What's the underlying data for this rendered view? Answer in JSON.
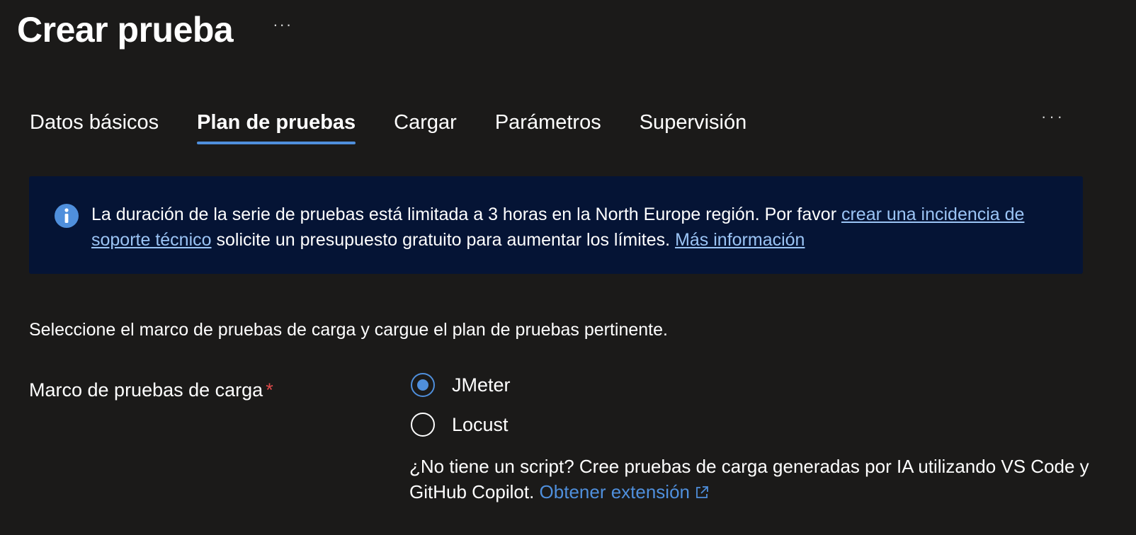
{
  "header": {
    "title": "Crear prueba",
    "more_label": "···"
  },
  "tabs": [
    {
      "label": "Datos básicos",
      "active": false
    },
    {
      "label": "Plan de pruebas",
      "active": true
    },
    {
      "label": "Cargar",
      "active": false
    },
    {
      "label": "Parámetros",
      "active": false
    },
    {
      "label": "Supervisión",
      "active": false
    }
  ],
  "tabs_more_label": "···",
  "info_banner": {
    "icon": "info-icon",
    "text_before": "La duración de la serie de pruebas está limitada a 3 horas en la North Europe región. Por favor ",
    "link1": "crear una incidencia de soporte técnico",
    "text_middle": " solicite un presupuesto gratuito para aumentar los límites. ",
    "link2": "Más información",
    "background": "#051435",
    "link_color": "#9bc4f5"
  },
  "instructions": "Seleccione el marco de pruebas de carga y cargue el plan de pruebas pertinente.",
  "framework_field": {
    "label": "Marco de pruebas de carga",
    "required_mark": "*",
    "options": [
      {
        "label": "JMeter",
        "selected": true
      },
      {
        "label": "Locust",
        "selected": false
      }
    ]
  },
  "helper": {
    "text": "¿No tiene un script? Cree pruebas de carga generadas por IA utilizando VS Code y GitHub Copilot. ",
    "link": "Obtener extensión",
    "link_icon": "external-link-icon"
  },
  "colors": {
    "background": "#1b1a19",
    "accent": "#4f8fdc",
    "required": "#e04b4b"
  }
}
